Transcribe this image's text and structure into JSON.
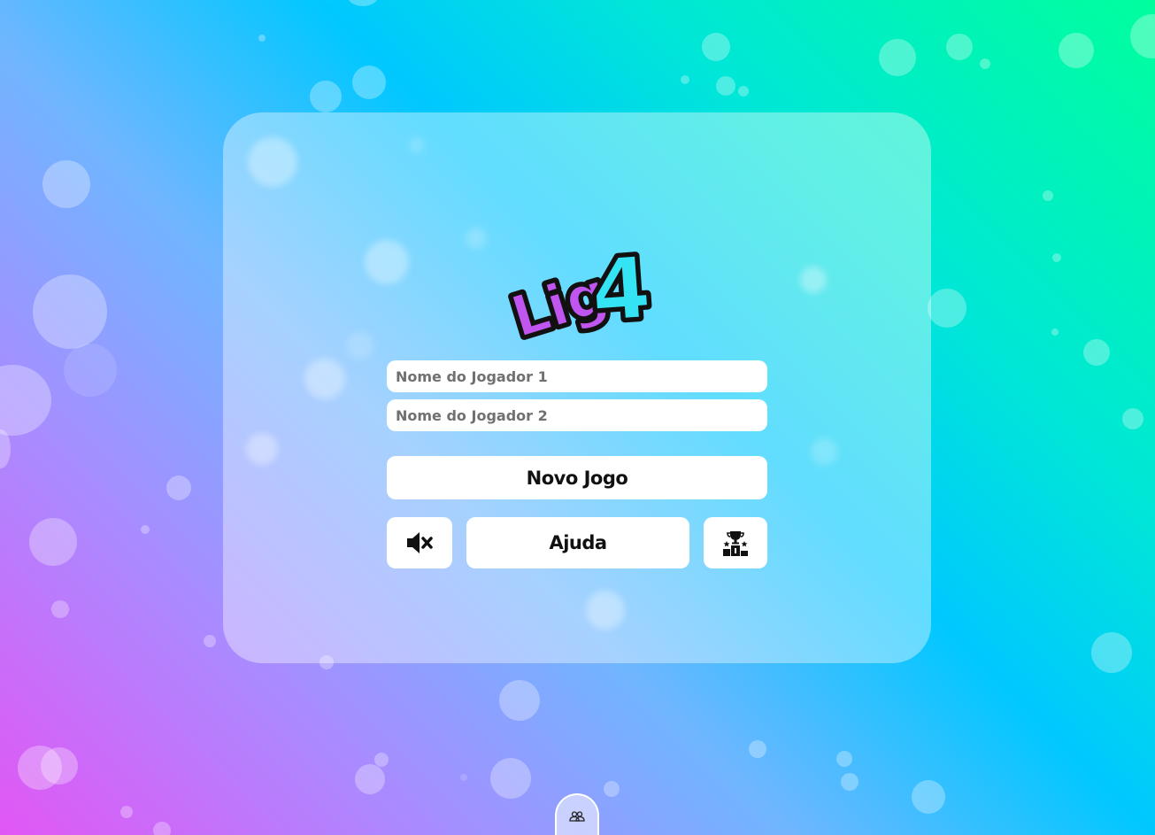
{
  "game": {
    "logo": {
      "text_main": "Lig",
      "text_number": "4",
      "main_color": "#c055f0",
      "number_color": "#35e4f4"
    },
    "inputs": {
      "player1_placeholder": "Nome do Jogador 1",
      "player1_value": "",
      "player2_placeholder": "Nome do Jogador 2",
      "player2_value": ""
    },
    "buttons": {
      "new_game_label": "Novo Jogo",
      "help_label": "Ajuda",
      "mute_icon": "volume-mute-icon",
      "ranking_icon": "trophy-podium-icon"
    },
    "bottom_tab": {
      "icon": "users-icon"
    }
  }
}
